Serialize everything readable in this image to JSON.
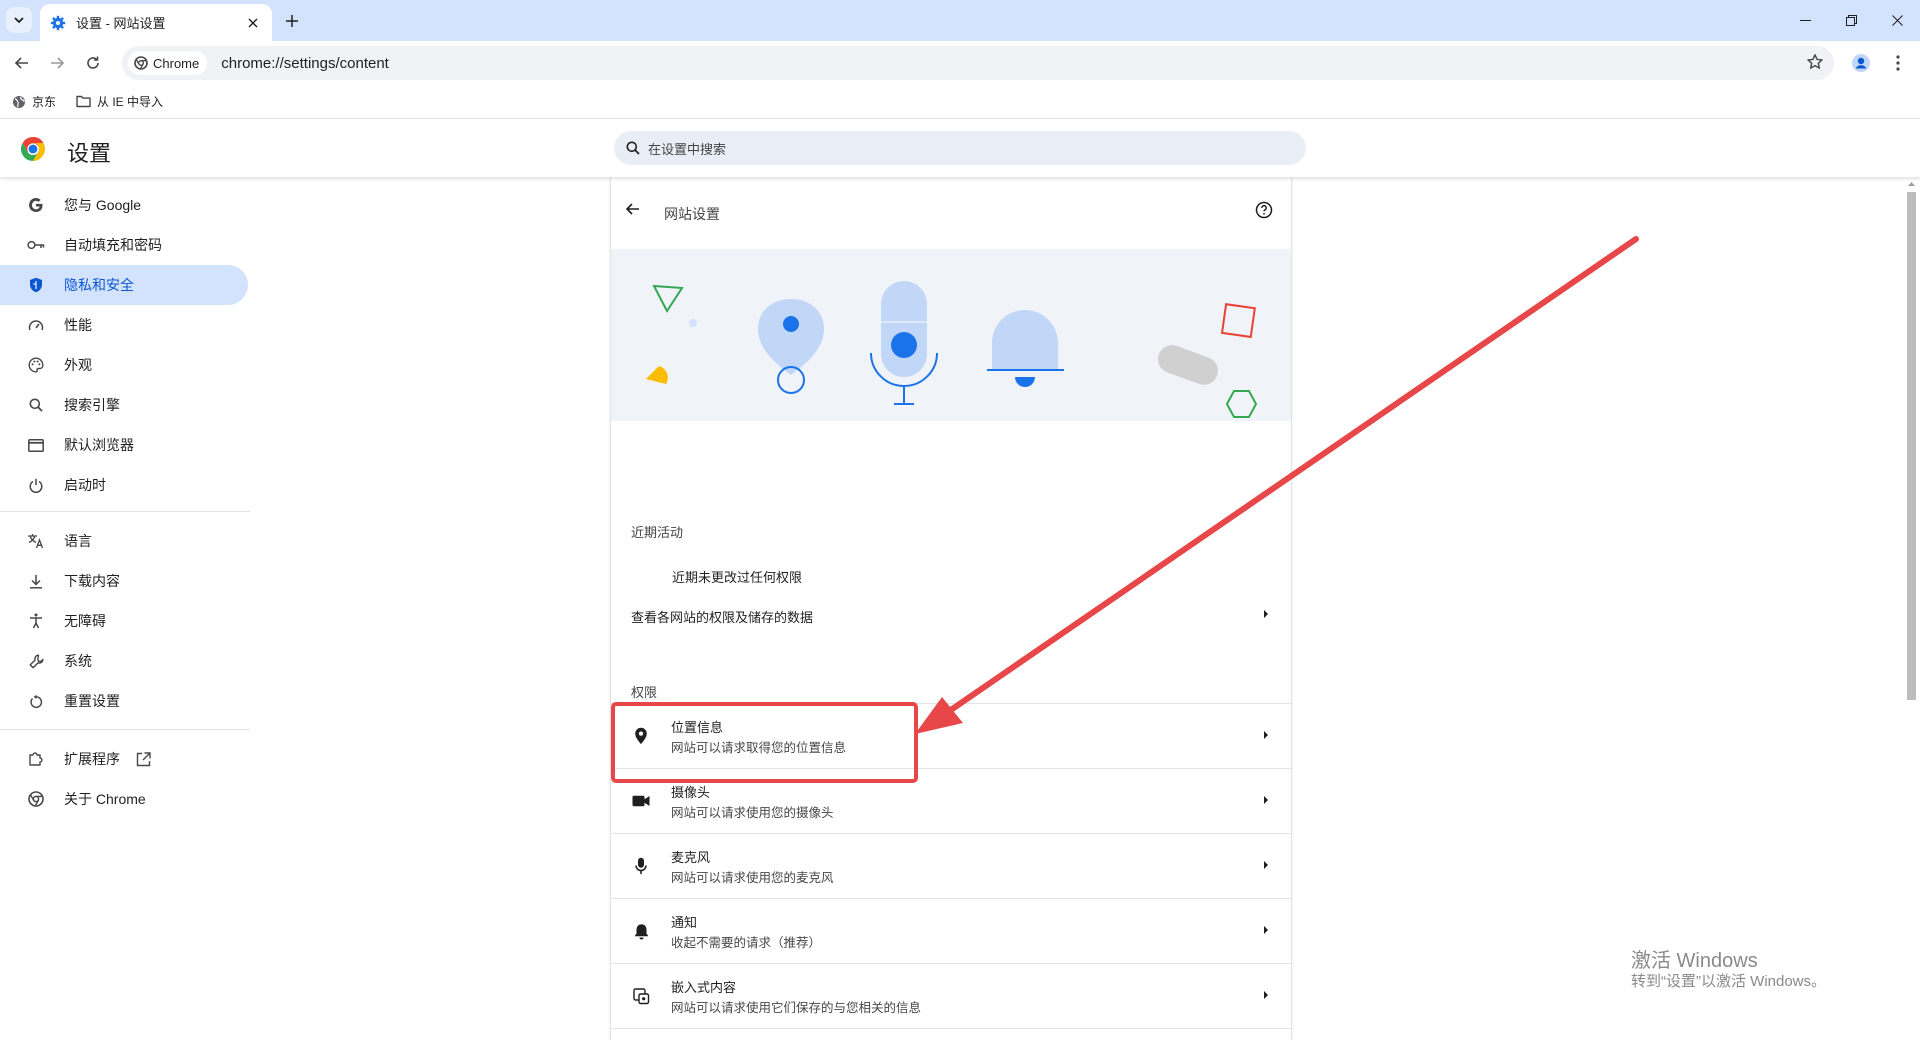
{
  "browser": {
    "tab_title": "设置 - 网站设置",
    "url_chip": "Chrome",
    "url": "chrome://settings/content",
    "bookmarks": [
      "京东",
      "从 IE 中导入"
    ]
  },
  "settings": {
    "title": "设置",
    "search_placeholder": "在设置中搜索"
  },
  "sidebar": {
    "items": [
      {
        "label": "您与 Google",
        "icon": "google-icon"
      },
      {
        "label": "自动填充和密码",
        "icon": "key-icon"
      },
      {
        "label": "隐私和安全",
        "icon": "shield-icon",
        "active": true
      },
      {
        "label": "性能",
        "icon": "speedometer-icon"
      },
      {
        "label": "外观",
        "icon": "palette-icon"
      },
      {
        "label": "搜索引擎",
        "icon": "search-icon"
      },
      {
        "label": "默认浏览器",
        "icon": "browser-icon"
      },
      {
        "label": "启动时",
        "icon": "power-icon"
      },
      {
        "label": "语言",
        "icon": "translate-icon"
      },
      {
        "label": "下载内容",
        "icon": "download-icon"
      },
      {
        "label": "无障碍",
        "icon": "accessibility-icon"
      },
      {
        "label": "系统",
        "icon": "wrench-icon"
      },
      {
        "label": "重置设置",
        "icon": "reset-icon"
      },
      {
        "label": "扩展程序",
        "icon": "puzzle-icon"
      },
      {
        "label": "关于 Chrome",
        "icon": "chrome-icon"
      }
    ]
  },
  "main": {
    "header_title": "网站设置",
    "recent_title": "近期活动",
    "recent_empty": "近期未更改过任何权限",
    "view_all": "查看各网站的权限及储存的数据",
    "permissions_title": "权限",
    "permissions": [
      {
        "title": "位置信息",
        "desc": "网站可以请求取得您的位置信息",
        "icon": "location-pin-icon"
      },
      {
        "title": "摄像头",
        "desc": "网站可以请求使用您的摄像头",
        "icon": "camera-icon"
      },
      {
        "title": "麦克风",
        "desc": "网站可以请求使用您的麦克风",
        "icon": "microphone-icon"
      },
      {
        "title": "通知",
        "desc": "收起不需要的请求（推荐）",
        "icon": "bell-icon"
      },
      {
        "title": "嵌入式内容",
        "desc": "网站可以请求使用它们保存的与您相关的信息",
        "icon": "embedded-content-icon"
      }
    ]
  },
  "watermark": {
    "line1": "激活 Windows",
    "line2": "转到“设置”以激活 Windows。"
  },
  "colors": {
    "accent": "#0b57d0",
    "annotation": "#e8474a",
    "titlebar": "#d3e3fd"
  }
}
